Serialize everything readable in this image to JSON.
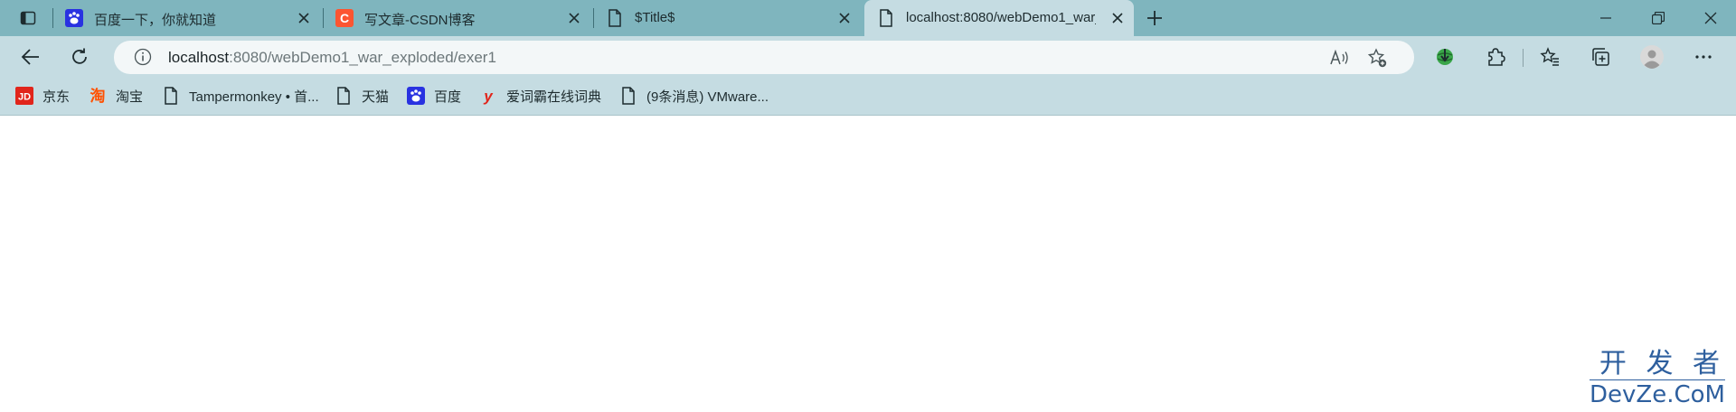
{
  "window": {
    "tabs": [
      {
        "title": "百度一下，你就知道",
        "favicon": "baidu-paw-icon",
        "active": false
      },
      {
        "title": "写文章-CSDN博客",
        "favicon": "csdn-logo-icon",
        "active": false
      },
      {
        "title": "$Title$",
        "favicon": "page-icon",
        "active": false
      },
      {
        "title": "localhost:8080/webDemo1_war_",
        "favicon": "page-icon",
        "active": true
      }
    ],
    "controls": [
      "minimize-icon",
      "restore-icon",
      "close-icon"
    ]
  },
  "toolbar": {
    "address": {
      "host": "localhost",
      "rest": ":8080/webDemo1_war_exploded/exer1"
    }
  },
  "bookmarks": [
    {
      "label": "京东",
      "icon": "jd-logo-icon"
    },
    {
      "label": "淘宝",
      "icon": "taobao-logo-icon"
    },
    {
      "label": "Tampermonkey • 首...",
      "icon": "page-icon"
    },
    {
      "label": "天猫",
      "icon": "page-icon"
    },
    {
      "label": "百度",
      "icon": "baidu-paw-icon"
    },
    {
      "label": "爱词霸在线词典",
      "icon": "iciba-logo-icon"
    },
    {
      "label": "(9条消息) VMware...",
      "icon": "page-icon"
    }
  ],
  "watermark": {
    "top": "开 发 者",
    "bottom": "DevZe.CoM"
  },
  "colors": {
    "tabstrip": "#7fb5be",
    "toolbar": "#c5dce2",
    "watermark": "#2e5f9e"
  }
}
